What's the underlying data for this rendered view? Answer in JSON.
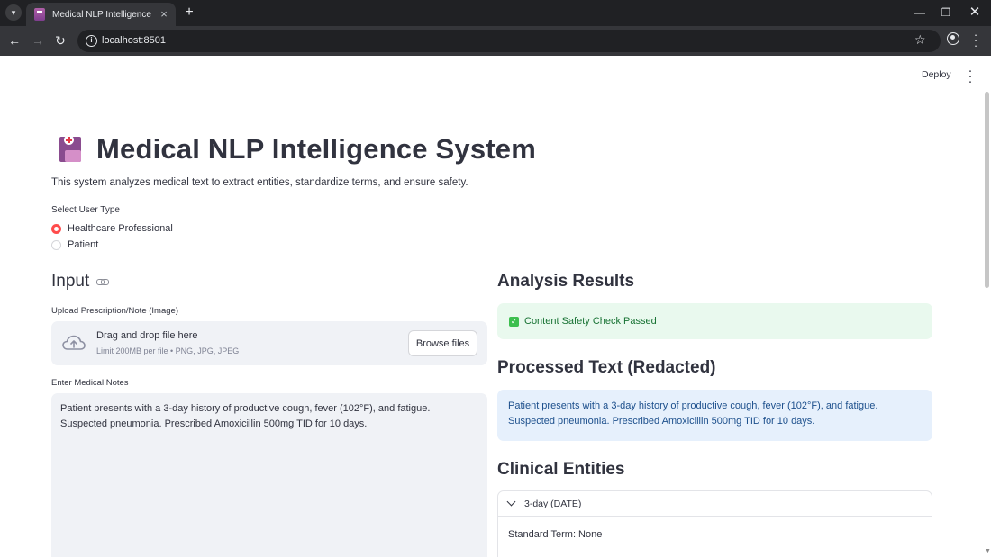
{
  "browser": {
    "tab_title": "Medical NLP Intelligence",
    "url": "localhost:8501"
  },
  "header": {
    "deploy_label": "Deploy"
  },
  "main": {
    "title": "Medical NLP Intelligence System",
    "description": "This system analyzes medical text to extract entities, standardize terms, and ensure safety.",
    "user_type": {
      "label": "Select User Type",
      "options": [
        "Healthcare Professional",
        "Patient"
      ],
      "selected": "Healthcare Professional"
    }
  },
  "input_section": {
    "heading": "Input",
    "upload": {
      "label": "Upload Prescription/Note (Image)",
      "drop_text": "Drag and drop file here",
      "limit_text": "Limit 200MB per file • PNG, JPG, JPEG",
      "browse_label": "Browse files"
    },
    "notes": {
      "label": "Enter Medical Notes",
      "value": "Patient presents with a 3-day history of productive cough, fever (102°F), and fatigue. Suspected pneumonia. Prescribed Amoxicillin 500mg TID for 10 days."
    }
  },
  "results_section": {
    "heading": "Analysis Results",
    "safety_status": "Content Safety Check Passed",
    "processed_heading": "Processed Text (Redacted)",
    "processed_text": "Patient presents with a 3-day history of productive cough, fever (102°F), and fatigue. Suspected pneumonia. Prescribed Amoxicillin 500mg TID for 10 days.",
    "entities_heading": "Clinical Entities",
    "entities": [
      {
        "label": "3-day (DATE)",
        "standard_term": "Standard Term: None"
      }
    ]
  },
  "colors": {
    "accent": "#ff4b4b",
    "success_bg": "#e9f9ee",
    "success_text": "#177233",
    "info_bg": "#e6f0fc",
    "info_text": "#1c4f8c",
    "text": "#31333f"
  },
  "icons": {
    "tab_favicon": "hospital-icon",
    "title_icon": "hospital-icon",
    "upload_icon": "cloud-upload-icon",
    "success_icon": "check-box-icon"
  }
}
